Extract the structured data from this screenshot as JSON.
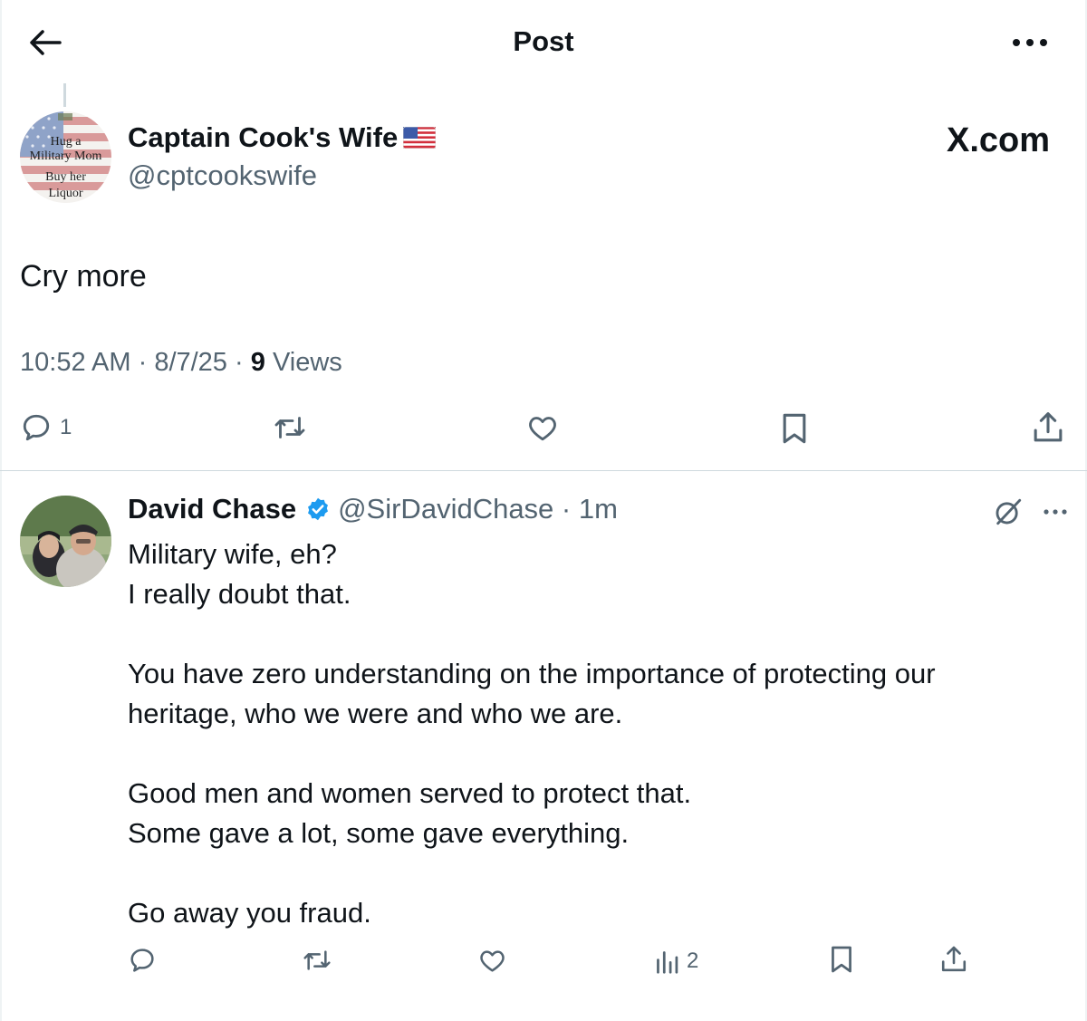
{
  "header": {
    "title": "Post"
  },
  "post": {
    "author_name": "Captain Cook's Wife",
    "author_handle": "@cptcookswife",
    "avatar_text": [
      "Hug a",
      "Military Mom",
      "Buy her",
      "Liquor"
    ],
    "brand": "X.com",
    "text": "Cry more",
    "time": "10:52 AM",
    "date": "8/7/25",
    "views_count": "9",
    "views_label": "Views",
    "reply_count": "1"
  },
  "reply": {
    "author_name": "David Chase",
    "author_handle": "@SirDavidChase",
    "time_ago": "1m",
    "lines": [
      "Military wife, eh?",
      "I really doubt that.",
      "",
      "You have zero understanding on the importance of protecting our",
      "heritage, who we were and who we are.",
      "",
      "Good men and women served to protect that.",
      "Some gave a lot, some gave everything.",
      "",
      "Go away you fraud."
    ],
    "views_count": "2"
  },
  "colors": {
    "text": "#0f1419",
    "secondary": "#536471",
    "divider": "#cfd9de",
    "verified": "#1d9bf0"
  },
  "icons": [
    "back-arrow-icon",
    "more-icon",
    "reply-icon",
    "repost-icon",
    "like-icon",
    "bookmark-icon",
    "share-icon",
    "verified-badge-icon",
    "grok-icon",
    "views-icon",
    "us-flag-icon"
  ]
}
